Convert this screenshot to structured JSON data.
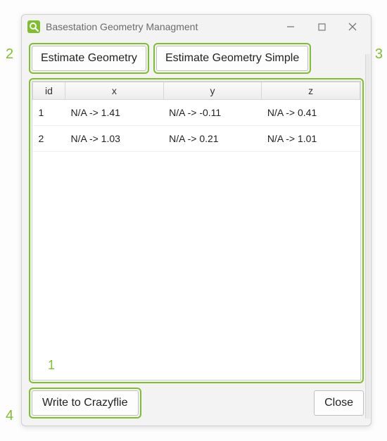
{
  "window": {
    "title": "Basestation Geometry Managment"
  },
  "buttons": {
    "estimate": "Estimate Geometry",
    "estimate_simple": "Estimate Geometry Simple",
    "write": "Write to Crazyflie",
    "close": "Close"
  },
  "table": {
    "headers": {
      "id": "id",
      "x": "x",
      "y": "y",
      "z": "z"
    },
    "rows": [
      {
        "id": "1",
        "x": "N/A -> 1.41",
        "y": "N/A -> -0.11",
        "z": "N/A -> 0.41"
      },
      {
        "id": "2",
        "x": "N/A -> 1.03",
        "y": "N/A -> 0.21",
        "z": "N/A -> 1.01"
      }
    ]
  },
  "annotations": {
    "table_area": "1",
    "estimate_btn": "2",
    "estimate_simple_btn": "3",
    "write_btn": "4"
  },
  "colors": {
    "highlight": "#7fbf2b"
  }
}
